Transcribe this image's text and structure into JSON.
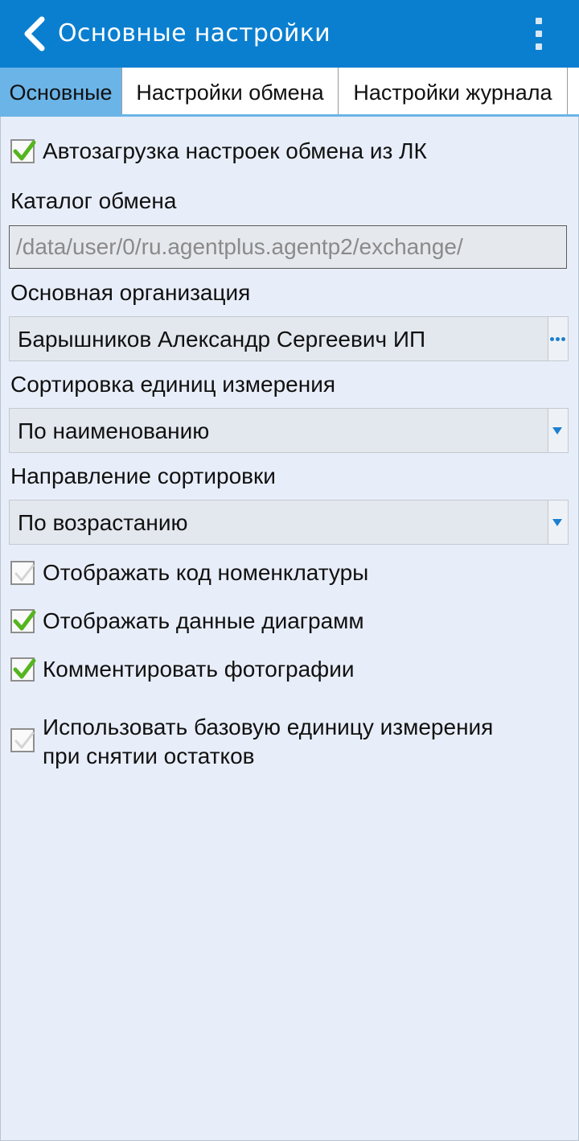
{
  "header": {
    "title": "Основные настройки"
  },
  "tabs": [
    {
      "label": "Основные",
      "active": true
    },
    {
      "label": "Настройки обмена",
      "active": false
    },
    {
      "label": "Настройки журнала",
      "active": false
    }
  ],
  "settings": {
    "autoload": {
      "label": "Автозагрузка настроек обмена из ЛК",
      "checked": true
    },
    "exchange_dir": {
      "label": "Каталог обмена",
      "value": "/data/user/0/ru.agentplus.agentp2/exchange/"
    },
    "organization": {
      "label": "Основная организация",
      "value": "Барышников Александр Сергеевич ИП"
    },
    "unit_sort": {
      "label": "Сортировка единиц измерения",
      "value": "По наименованию"
    },
    "sort_direction": {
      "label": "Направление сортировки",
      "value": "По возрастанию"
    },
    "show_code": {
      "label": "Отображать код номенклатуры",
      "checked": false
    },
    "show_charts": {
      "label": "Отображать данные диаграмм",
      "checked": true
    },
    "comment_photos": {
      "label": "Комментировать фотографии",
      "checked": true
    },
    "base_unit": {
      "label_line1": "Использовать базовую единицу измерения",
      "label_line2": "при снятии остатков",
      "checked": false
    }
  },
  "colors": {
    "appbar": "#0a7fd0",
    "active_tab": "#6bb4e8",
    "content_bg": "#e8eef9",
    "check_green": "#55b51f",
    "accent_blue": "#1c7fd0"
  },
  "icons": {
    "back": "chevron-left-icon",
    "menu": "more-vertical-icon",
    "ellipsis": "ellipsis-icon",
    "dropdown": "caret-down-icon"
  }
}
